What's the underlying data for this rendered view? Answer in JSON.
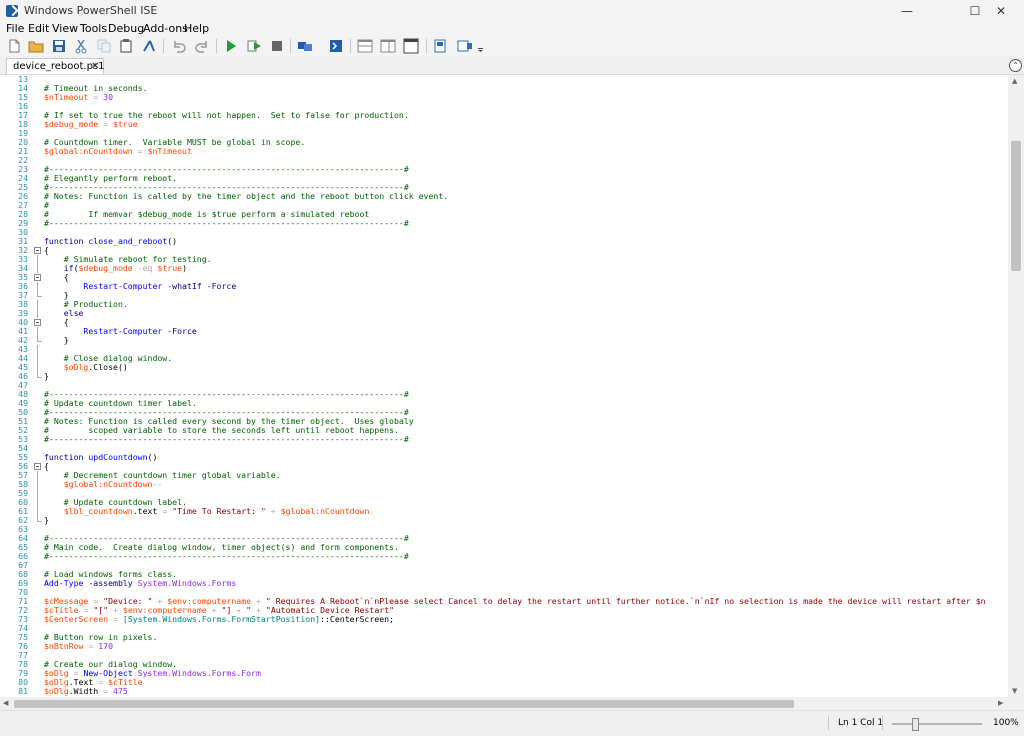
{
  "window": {
    "title": "Windows PowerShell ISE",
    "minimize_label": "—",
    "maximize_label": "☐",
    "close_label": "✕"
  },
  "menu": [
    "File",
    "Edit",
    "View",
    "Tools",
    "Debug",
    "Add-ons",
    "Help"
  ],
  "toolbar": {
    "buttons": [
      {
        "name": "new-file-icon",
        "color": "#e6e6e6"
      },
      {
        "name": "open-folder-icon",
        "color": "#e8b44a"
      },
      {
        "name": "save-icon",
        "color": "#2e5f9e"
      },
      {
        "name": "cut-icon",
        "color": "#5a7fb0"
      },
      {
        "name": "copy-icon",
        "color": "#b7c4d6"
      },
      {
        "name": "paste-icon",
        "color": "#666666"
      },
      {
        "name": "clear-console-icon",
        "color": "#2a5fb0"
      },
      {
        "name": "undo-icon",
        "color": "#9a9a9a"
      },
      {
        "name": "redo-icon",
        "color": "#9a9a9a"
      },
      {
        "name": "run-script-icon",
        "color": "#1e9e3a"
      },
      {
        "name": "run-selection-icon",
        "color": "#3a8f3a"
      },
      {
        "name": "stop-icon",
        "color": "#666666"
      },
      {
        "name": "new-remote-tab-icon",
        "color": "#2458b0"
      },
      {
        "name": "start-powershell-icon",
        "color": "#1f5fa8"
      },
      {
        "name": "show-script-pane-top-icon",
        "color": "#888888"
      },
      {
        "name": "show-script-pane-right-icon",
        "color": "#888888"
      },
      {
        "name": "show-script-pane-maximized-icon",
        "color": "#444444"
      },
      {
        "name": "show-command-window-icon",
        "color": "#2d6cb5"
      },
      {
        "name": "show-command-addon-icon",
        "color": "#2d6cb5"
      },
      {
        "name": "toolbar-overflow-icon",
        "color": "#444444"
      }
    ]
  },
  "tab": {
    "label": "device_reboot.ps1",
    "close": "✕"
  },
  "collapse_button": "⌃",
  "editor": {
    "lines": [
      {
        "n": "13",
        "fold": "",
        "tokens": []
      },
      {
        "n": "14",
        "fold": "",
        "tokens": [
          {
            "t": "comment",
            "v": "# Timeout in seconds."
          }
        ]
      },
      {
        "n": "15",
        "fold": "",
        "tokens": [
          {
            "t": "variable",
            "v": "$nTimeout"
          },
          {
            "t": "operator",
            "v": " = "
          },
          {
            "t": "commandarg",
            "v": "30"
          }
        ]
      },
      {
        "n": "16",
        "fold": "",
        "tokens": []
      },
      {
        "n": "17",
        "fold": "",
        "tokens": [
          {
            "t": "comment",
            "v": "# If set to true the reboot will not happen.  Set to false for production."
          }
        ]
      },
      {
        "n": "18",
        "fold": "",
        "tokens": [
          {
            "t": "variable",
            "v": "$debug_mode"
          },
          {
            "t": "operator",
            "v": " = "
          },
          {
            "t": "variable",
            "v": "$true"
          }
        ]
      },
      {
        "n": "19",
        "fold": "",
        "tokens": []
      },
      {
        "n": "20",
        "fold": "",
        "tokens": [
          {
            "t": "comment",
            "v": "# Countdown timer.  Variable MUST be global in scope."
          }
        ]
      },
      {
        "n": "21",
        "fold": "",
        "tokens": [
          {
            "t": "variable",
            "v": "$global:nCountdown"
          },
          {
            "t": "operator",
            "v": " = "
          },
          {
            "t": "variable",
            "v": "$nTimeout"
          }
        ]
      },
      {
        "n": "22",
        "fold": "",
        "tokens": []
      },
      {
        "n": "23",
        "fold": "",
        "tokens": [
          {
            "t": "comment",
            "v": "#------------------------------------------------------------------------#"
          }
        ]
      },
      {
        "n": "24",
        "fold": "",
        "tokens": [
          {
            "t": "comment",
            "v": "# Elegantly perform reboot."
          }
        ]
      },
      {
        "n": "25",
        "fold": "",
        "tokens": [
          {
            "t": "comment",
            "v": "#------------------------------------------------------------------------#"
          }
        ]
      },
      {
        "n": "26",
        "fold": "",
        "tokens": [
          {
            "t": "comment",
            "v": "# Notes: Function is called by the timer object and the reboot button click event."
          }
        ]
      },
      {
        "n": "27",
        "fold": "",
        "tokens": [
          {
            "t": "comment",
            "v": "#"
          }
        ]
      },
      {
        "n": "28",
        "fold": "",
        "tokens": [
          {
            "t": "comment",
            "v": "#        If memvar $debug_mode is $true perform a simulated reboot"
          }
        ]
      },
      {
        "n": "29",
        "fold": "",
        "tokens": [
          {
            "t": "comment",
            "v": "#------------------------------------------------------------------------#"
          }
        ]
      },
      {
        "n": "30",
        "fold": "",
        "tokens": []
      },
      {
        "n": "31",
        "fold": "",
        "tokens": [
          {
            "t": "keyword",
            "v": "function"
          },
          {
            "t": "text",
            "v": " "
          },
          {
            "t": "command",
            "v": "close_and_reboot"
          },
          {
            "t": "text",
            "v": "()"
          }
        ]
      },
      {
        "n": "32",
        "fold": "open",
        "tokens": [
          {
            "t": "text",
            "v": "{"
          }
        ]
      },
      {
        "n": "33",
        "fold": "bar",
        "tokens": [
          {
            "t": "comment",
            "v": "    # Simulate reboot for testing."
          }
        ]
      },
      {
        "n": "34",
        "fold": "bar",
        "tokens": [
          {
            "t": "keyword",
            "v": "    if"
          },
          {
            "t": "text",
            "v": "("
          },
          {
            "t": "variable",
            "v": "$debug_mode"
          },
          {
            "t": "operator",
            "v": " -eq "
          },
          {
            "t": "variable",
            "v": "$true"
          },
          {
            "t": "text",
            "v": ")"
          }
        ]
      },
      {
        "n": "35",
        "fold": "open",
        "tokens": [
          {
            "t": "text",
            "v": "    {"
          }
        ]
      },
      {
        "n": "36",
        "fold": "bar",
        "tokens": [
          {
            "t": "command",
            "v": "        Restart-Computer"
          },
          {
            "t": "parameter",
            "v": " -whatIf -Force"
          }
        ]
      },
      {
        "n": "37",
        "fold": "end",
        "tokens": [
          {
            "t": "text",
            "v": "    }"
          }
        ]
      },
      {
        "n": "38",
        "fold": "bar",
        "tokens": [
          {
            "t": "comment",
            "v": "    # Production."
          }
        ]
      },
      {
        "n": "39",
        "fold": "bar",
        "tokens": [
          {
            "t": "keyword",
            "v": "    else"
          }
        ]
      },
      {
        "n": "40",
        "fold": "open",
        "tokens": [
          {
            "t": "text",
            "v": "    {"
          }
        ]
      },
      {
        "n": "41",
        "fold": "bar",
        "tokens": [
          {
            "t": "command",
            "v": "        Restart-Computer"
          },
          {
            "t": "parameter",
            "v": " -Force"
          }
        ]
      },
      {
        "n": "42",
        "fold": "end",
        "tokens": [
          {
            "t": "text",
            "v": "    }"
          }
        ]
      },
      {
        "n": "43",
        "fold": "bar",
        "tokens": []
      },
      {
        "n": "44",
        "fold": "bar",
        "tokens": [
          {
            "t": "comment",
            "v": "    # Close dialog window."
          }
        ]
      },
      {
        "n": "45",
        "fold": "bar",
        "tokens": [
          {
            "t": "variable",
            "v": "    $oDlg"
          },
          {
            "t": "text",
            "v": ".Close()"
          }
        ]
      },
      {
        "n": "46",
        "fold": "end",
        "tokens": [
          {
            "t": "text",
            "v": "}"
          }
        ]
      },
      {
        "n": "47",
        "fold": "",
        "tokens": []
      },
      {
        "n": "48",
        "fold": "",
        "tokens": [
          {
            "t": "comment",
            "v": "#------------------------------------------------------------------------#"
          }
        ]
      },
      {
        "n": "49",
        "fold": "",
        "tokens": [
          {
            "t": "comment",
            "v": "# Update countdown timer label."
          }
        ]
      },
      {
        "n": "50",
        "fold": "",
        "tokens": [
          {
            "t": "comment",
            "v": "#------------------------------------------------------------------------#"
          }
        ]
      },
      {
        "n": "51",
        "fold": "",
        "tokens": [
          {
            "t": "comment",
            "v": "# Notes: Function is called every second by the timer object.  Uses globaly"
          }
        ]
      },
      {
        "n": "52",
        "fold": "",
        "tokens": [
          {
            "t": "comment",
            "v": "#        scoped variable to store the seconds left until reboot happens."
          }
        ]
      },
      {
        "n": "53",
        "fold": "",
        "tokens": [
          {
            "t": "comment",
            "v": "#------------------------------------------------------------------------#"
          }
        ]
      },
      {
        "n": "54",
        "fold": "",
        "tokens": []
      },
      {
        "n": "55",
        "fold": "",
        "tokens": [
          {
            "t": "keyword",
            "v": "function"
          },
          {
            "t": "text",
            "v": " "
          },
          {
            "t": "command",
            "v": "updCountdown"
          },
          {
            "t": "text",
            "v": "()"
          }
        ]
      },
      {
        "n": "56",
        "fold": "open",
        "tokens": [
          {
            "t": "text",
            "v": "{"
          }
        ]
      },
      {
        "n": "57",
        "fold": "bar",
        "tokens": [
          {
            "t": "comment",
            "v": "    # Decrement countdown timer global variable."
          }
        ]
      },
      {
        "n": "58",
        "fold": "bar",
        "tokens": [
          {
            "t": "variable",
            "v": "    $global:nCountdown"
          },
          {
            "t": "operator",
            "v": "--"
          }
        ]
      },
      {
        "n": "59",
        "fold": "bar",
        "tokens": []
      },
      {
        "n": "60",
        "fold": "bar",
        "tokens": [
          {
            "t": "comment",
            "v": "    # Update countdown label."
          }
        ]
      },
      {
        "n": "61",
        "fold": "bar",
        "tokens": [
          {
            "t": "variable",
            "v": "    $lbl_countdown"
          },
          {
            "t": "text",
            "v": ".text"
          },
          {
            "t": "operator",
            "v": " = "
          },
          {
            "t": "string",
            "v": "\"Time To Restart: \""
          },
          {
            "t": "operator",
            "v": " + "
          },
          {
            "t": "variable",
            "v": "$global:nCountdown"
          }
        ]
      },
      {
        "n": "62",
        "fold": "end",
        "tokens": [
          {
            "t": "text",
            "v": "}"
          }
        ]
      },
      {
        "n": "63",
        "fold": "",
        "tokens": []
      },
      {
        "n": "64",
        "fold": "",
        "tokens": [
          {
            "t": "comment",
            "v": "#------------------------------------------------------------------------#"
          }
        ]
      },
      {
        "n": "65",
        "fold": "",
        "tokens": [
          {
            "t": "comment",
            "v": "# Main code.  Create dialog window, timer object(s) and form components."
          }
        ]
      },
      {
        "n": "66",
        "fold": "",
        "tokens": [
          {
            "t": "comment",
            "v": "#------------------------------------------------------------------------#"
          }
        ]
      },
      {
        "n": "67",
        "fold": "",
        "tokens": []
      },
      {
        "n": "68",
        "fold": "",
        "tokens": [
          {
            "t": "comment",
            "v": "# Load windows forms class."
          }
        ]
      },
      {
        "n": "69",
        "fold": "",
        "tokens": [
          {
            "t": "command",
            "v": "Add-Type"
          },
          {
            "t": "parameter",
            "v": " -assembly"
          },
          {
            "t": "commandarg",
            "v": " System.Windows.Forms"
          }
        ]
      },
      {
        "n": "70",
        "fold": "",
        "tokens": []
      },
      {
        "n": "71",
        "fold": "",
        "tokens": [
          {
            "t": "variable",
            "v": "$cMessage"
          },
          {
            "t": "operator",
            "v": " = "
          },
          {
            "t": "string",
            "v": "\"Device: \""
          },
          {
            "t": "operator",
            "v": " + "
          },
          {
            "t": "variable",
            "v": "$env:computername"
          },
          {
            "t": "operator",
            "v": " + "
          },
          {
            "t": "string",
            "v": "\" Requires A Reboot`n`nPlease select Cancel to delay the restart until further notice.`n`nIf no selection is made the device will restart after $n"
          }
        ]
      },
      {
        "n": "72",
        "fold": "",
        "tokens": [
          {
            "t": "variable",
            "v": "$cTitle"
          },
          {
            "t": "operator",
            "v": " = "
          },
          {
            "t": "string",
            "v": "\"[\""
          },
          {
            "t": "operator",
            "v": " + "
          },
          {
            "t": "variable",
            "v": "$env:computername"
          },
          {
            "t": "operator",
            "v": " + "
          },
          {
            "t": "string",
            "v": "\"] - \""
          },
          {
            "t": "operator",
            "v": " + "
          },
          {
            "t": "string",
            "v": "\"Automatic Device Restart\""
          }
        ]
      },
      {
        "n": "73",
        "fold": "",
        "tokens": [
          {
            "t": "variable",
            "v": "$CenterScreen"
          },
          {
            "t": "operator",
            "v": " = "
          },
          {
            "t": "type",
            "v": "[System.Windows.Forms.FormStartPosition]"
          },
          {
            "t": "text",
            "v": "::CenterScreen;"
          }
        ]
      },
      {
        "n": "74",
        "fold": "",
        "tokens": []
      },
      {
        "n": "75",
        "fold": "",
        "tokens": [
          {
            "t": "comment",
            "v": "# Button row in pixels."
          }
        ]
      },
      {
        "n": "76",
        "fold": "",
        "tokens": [
          {
            "t": "variable",
            "v": "$nBtnRow"
          },
          {
            "t": "operator",
            "v": " = "
          },
          {
            "t": "commandarg",
            "v": "170"
          }
        ]
      },
      {
        "n": "77",
        "fold": "",
        "tokens": []
      },
      {
        "n": "78",
        "fold": "",
        "tokens": [
          {
            "t": "comment",
            "v": "# Create our dialog window."
          }
        ]
      },
      {
        "n": "79",
        "fold": "",
        "tokens": [
          {
            "t": "variable",
            "v": "$oDlg"
          },
          {
            "t": "operator",
            "v": " = "
          },
          {
            "t": "command",
            "v": "New-Object"
          },
          {
            "t": "commandarg",
            "v": " System.Windows.Forms.Form"
          }
        ]
      },
      {
        "n": "80",
        "fold": "",
        "tokens": [
          {
            "t": "variable",
            "v": "$oDlg"
          },
          {
            "t": "text",
            "v": ".Text"
          },
          {
            "t": "operator",
            "v": " = "
          },
          {
            "t": "variable",
            "v": "$cTitle"
          }
        ]
      },
      {
        "n": "81",
        "fold": "",
        "tokens": [
          {
            "t": "variable",
            "v": "$oDlg"
          },
          {
            "t": "text",
            "v": ".Width"
          },
          {
            "t": "operator",
            "v": " = "
          },
          {
            "t": "commandarg",
            "v": "475"
          }
        ]
      }
    ]
  },
  "status": {
    "position": "Ln 1  Col 1",
    "zoom": "100%",
    "zoom_fraction": 0.22
  }
}
